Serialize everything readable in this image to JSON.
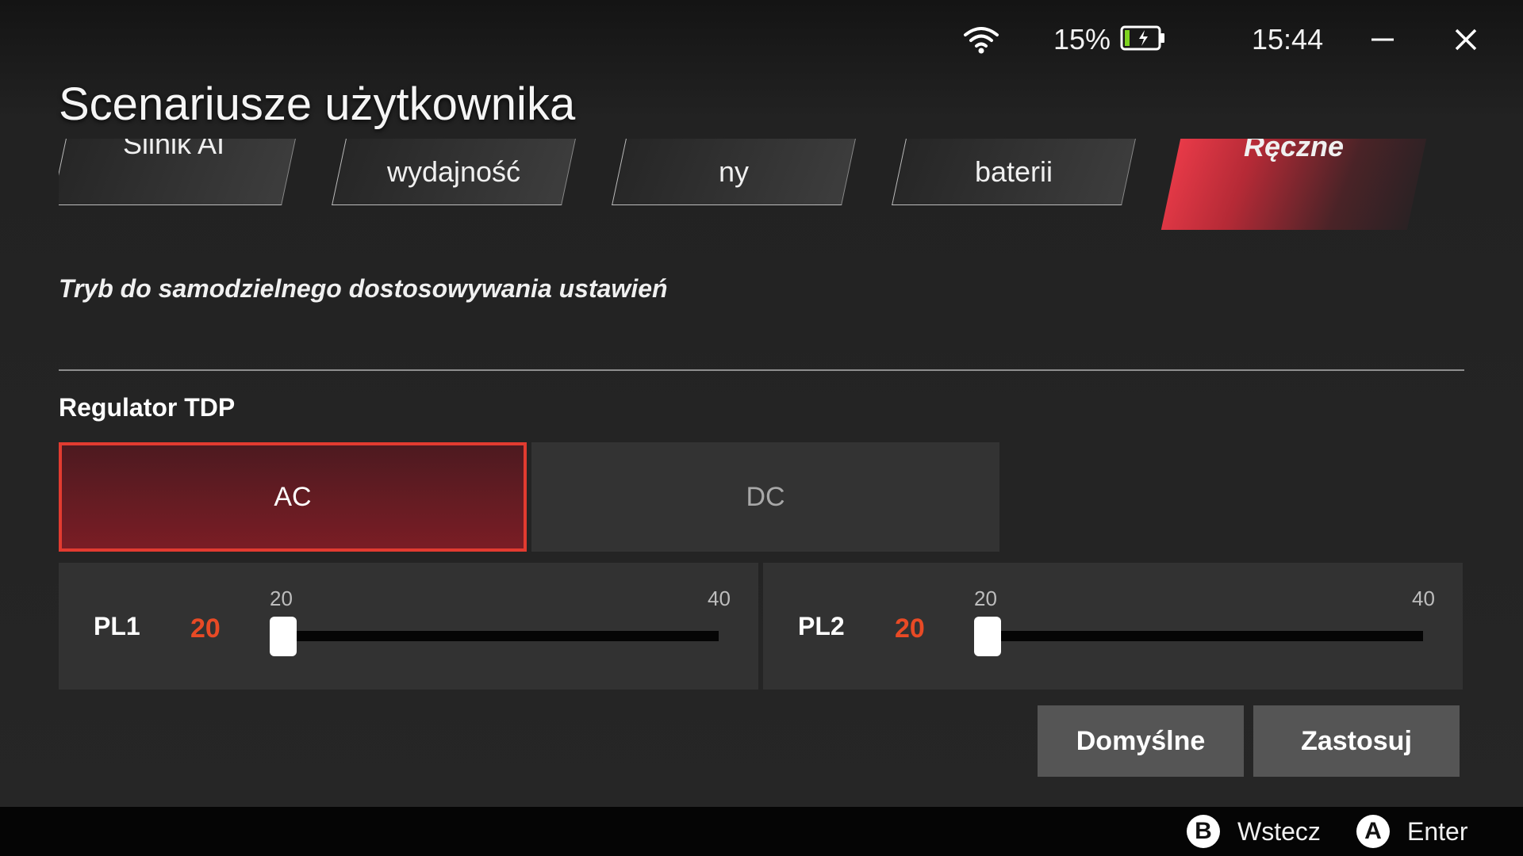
{
  "status_bar": {
    "wifi_icon": "wifi-icon",
    "battery_percent": "15%",
    "battery_icon": "battery-charging-icon",
    "battery_level": 0.15,
    "battery_fill_color": "#7ed321",
    "time": "15:44"
  },
  "window_controls": {
    "minimize_icon": "minimize-icon",
    "close_icon": "close-icon"
  },
  "page": {
    "title": "Scenariusze użytkownika"
  },
  "tabs": [
    {
      "label": "Silnik AI",
      "active": false
    },
    {
      "label": "wydajność",
      "active": false
    },
    {
      "label": "ny",
      "active": false
    },
    {
      "label": "baterii",
      "active": false
    },
    {
      "label": "Ręczne",
      "active": true
    }
  ],
  "description": "Tryb do samodzielnego dostosowywania ustawień",
  "tdp": {
    "title": "Regulator TDP",
    "modes": [
      {
        "label": "AC",
        "selected": true
      },
      {
        "label": "DC",
        "selected": false
      }
    ],
    "sliders": [
      {
        "label": "PL1",
        "value": "20",
        "min": "20",
        "max": "40",
        "current": 20
      },
      {
        "label": "PL2",
        "value": "20",
        "min": "20",
        "max": "40",
        "current": 20
      }
    ],
    "value_color": "#e84a25",
    "accent_color": "#e23b30"
  },
  "actions": {
    "default_label": "Domyślne",
    "apply_label": "Zastosuj"
  },
  "footer": {
    "back": {
      "key": "B",
      "label": "Wstecz"
    },
    "enter": {
      "key": "A",
      "label": "Enter"
    }
  }
}
